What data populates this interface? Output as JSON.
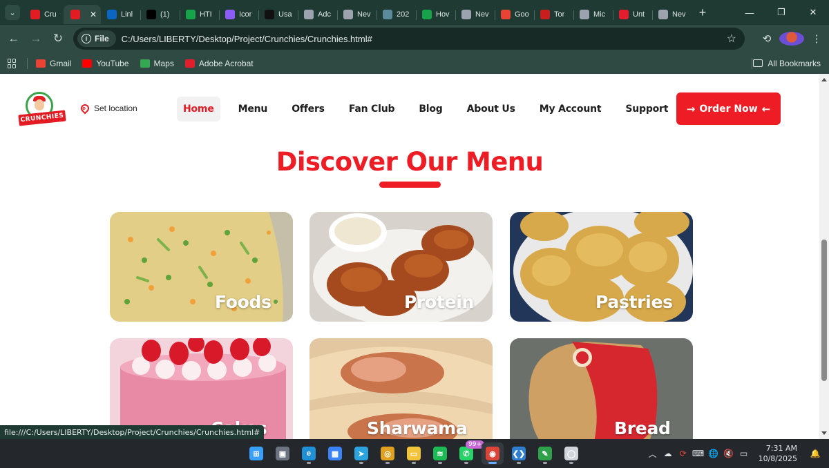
{
  "browser": {
    "tab_menu_icon": "chevron-down-icon",
    "tabs": [
      {
        "label": "Cru",
        "icon": "crunchies-favicon",
        "color": "#e31b23",
        "active": false
      },
      {
        "label": "",
        "icon": "crunchies-favicon",
        "color": "#e31b23",
        "active": true
      },
      {
        "label": "Linl",
        "icon": "linkedin-icon",
        "color": "#0a66c2",
        "active": false
      },
      {
        "label": "(1)",
        "icon": "x-icon",
        "color": "#000000",
        "active": false
      },
      {
        "label": "HTI",
        "icon": "w-icon",
        "color": "#16a34a",
        "active": false
      },
      {
        "label": "Icor",
        "icon": "cube-icon",
        "color": "#8b5cf6",
        "active": false
      },
      {
        "label": "Usa",
        "icon": "circle-icon",
        "color": "#111111",
        "active": false
      },
      {
        "label": "Adc",
        "icon": "globe-icon",
        "color": "#9ca3af",
        "active": false
      },
      {
        "label": "Nev",
        "icon": "chrome-icon",
        "color": "#9ca3af",
        "active": false
      },
      {
        "label": "202",
        "icon": "image-icon",
        "color": "#5b8a9a",
        "active": false
      },
      {
        "label": "Hov",
        "icon": "w-icon",
        "color": "#16a34a",
        "active": false
      },
      {
        "label": "Nev",
        "icon": "chrome-icon",
        "color": "#9ca3af",
        "active": false
      },
      {
        "label": "Goo",
        "icon": "google-icon",
        "color": "#ea4335",
        "active": false
      },
      {
        "label": "Tor",
        "icon": "brand-icon",
        "color": "#c81e1e",
        "active": false
      },
      {
        "label": "Mic",
        "icon": "globe-icon",
        "color": "#9ca3af",
        "active": false
      },
      {
        "label": "Unt",
        "icon": "pdf-icon",
        "color": "#e11d2e",
        "active": false
      },
      {
        "label": "Nev",
        "icon": "chrome-icon",
        "color": "#9ca3af",
        "active": false
      }
    ],
    "url_scheme_label": "File",
    "url": "C:/Users/LIBERTY/Desktop/Project/Crunchies/Crunchies.html#",
    "bookmarks": [
      {
        "label": "Gmail",
        "color": "#ea4335"
      },
      {
        "label": "YouTube",
        "color": "#ff0000"
      },
      {
        "label": "Maps",
        "color": "#34a853"
      },
      {
        "label": "Adobe Acrobat",
        "color": "#e11d2e"
      }
    ],
    "all_bookmarks_label": "All Bookmarks",
    "status_url": "file:///C:/Users/LIBERTY/Desktop/Project/Crunchies/Crunchies.html#"
  },
  "site": {
    "logo_text": "CRUNCHIES",
    "location_label": "Set location",
    "nav": [
      "Home",
      "Menu",
      "Offers",
      "Fan Club",
      "Blog",
      "About Us",
      "My Account",
      "Support"
    ],
    "active_nav": "Home",
    "order_button": "Order Now",
    "section_title": "Discover Our Menu",
    "accent_color": "#ee1c25",
    "menu_cards": [
      {
        "label": "Foods",
        "image": "fried-rice-image"
      },
      {
        "label": "Protein",
        "image": "fried-chicken-image"
      },
      {
        "label": "Pastries",
        "image": "meat-pie-image"
      },
      {
        "label": "Cakes",
        "image": "strawberry-cake-image"
      },
      {
        "label": "Sharwama",
        "image": "shawarma-image"
      },
      {
        "label": "Bread",
        "image": "bread-loaf-image"
      }
    ]
  },
  "taskbar": {
    "apps": [
      "windows-start",
      "task-view",
      "edge",
      "store",
      "telegram",
      "chrome-canary",
      "file-explorer",
      "spotify",
      "whatsapp",
      "chrome",
      "vscode",
      "notepad",
      "app"
    ],
    "whatsapp_badge": "99+",
    "time": "7:31 AM",
    "date": "10/8/2025"
  }
}
